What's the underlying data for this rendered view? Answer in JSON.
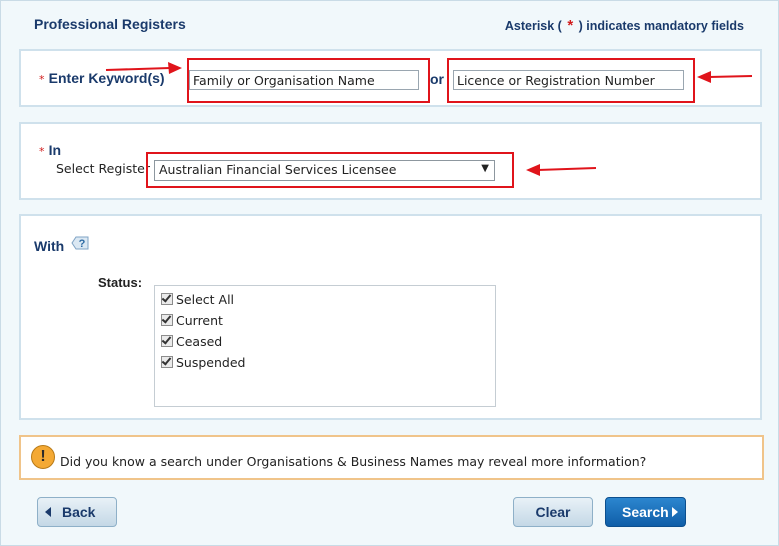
{
  "header": {
    "title": "Professional Registers",
    "mandatory_prefix": "Asterisk (",
    "mandatory_star": "*",
    "mandatory_suffix": ") indicates mandatory fields"
  },
  "keyword": {
    "required_mark": "*",
    "label": "Enter Keyword(s)",
    "name_value": "Family or Organisation Name",
    "or_label": "or",
    "licence_value": "Licence or Registration Number"
  },
  "register": {
    "required_mark": "*",
    "label": "In",
    "select_label": "Select Register",
    "selected": "Australian Financial Services Licensee",
    "caret": "▼"
  },
  "with": {
    "label": "With",
    "help_icon": "help-question-icon",
    "status_label": "Status:",
    "options": [
      {
        "label": "Select All",
        "checked": true
      },
      {
        "label": "Current",
        "checked": true
      },
      {
        "label": "Ceased",
        "checked": true
      },
      {
        "label": "Suspended",
        "checked": true
      }
    ]
  },
  "info": {
    "icon": "!",
    "text": "Did you know a search under Organisations & Business Names may reveal more information?"
  },
  "buttons": {
    "back": "Back",
    "clear": "Clear",
    "search": "Search"
  },
  "colors": {
    "annotation_red": "#e0141b",
    "heading_blue": "#1a3a6b",
    "search_blue": "#1a6fbd",
    "info_border": "#f0c48a"
  }
}
